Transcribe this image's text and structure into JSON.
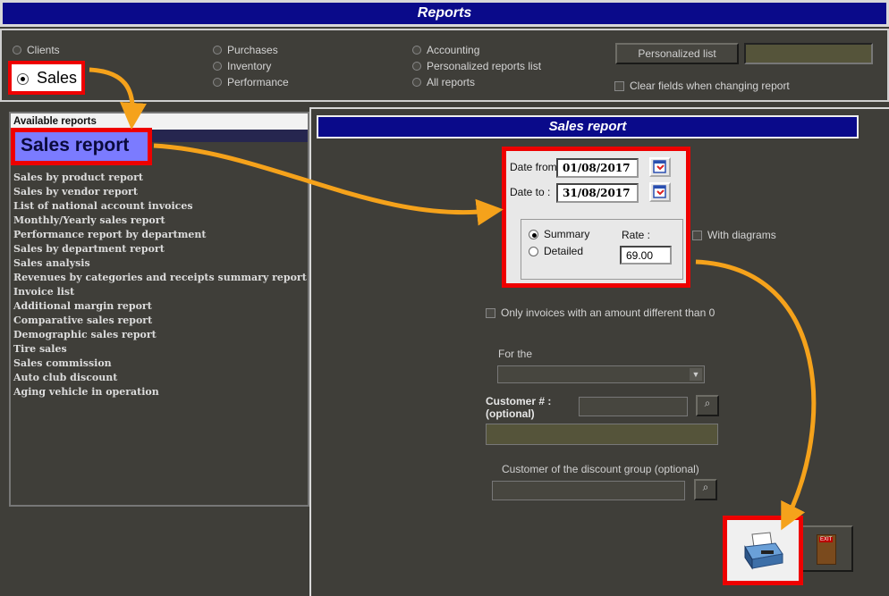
{
  "window": {
    "title": "Reports"
  },
  "report_types": {
    "col1": [
      {
        "label": "Clients",
        "selected": false
      },
      {
        "label": "Sales",
        "selected": true
      }
    ],
    "col2": [
      {
        "label": "Purchases",
        "selected": false
      },
      {
        "label": "Inventory",
        "selected": false
      },
      {
        "label": "Performance",
        "selected": false
      }
    ],
    "col3": [
      {
        "label": "Accounting",
        "selected": false
      },
      {
        "label": "Personalized reports list",
        "selected": false
      },
      {
        "label": "All reports",
        "selected": false
      }
    ]
  },
  "personalized_list": {
    "button_label": "Personalized list",
    "value": ""
  },
  "clear_fields": {
    "label": "Clear fields when changing report",
    "checked": false
  },
  "available_reports": {
    "header": "Available reports",
    "selected": "Sales report",
    "items": [
      "Sales report",
      "Sales by product report",
      "Sales by vendor report",
      "List of national account invoices",
      "Monthly/Yearly sales report",
      "Performance report by department",
      "Sales by department report",
      "Sales analysis",
      "Revenues by categories and receipts summary report",
      "Invoice list",
      "Additional margin report",
      "Comparative sales report",
      "Demographic sales report",
      "Tire sales",
      "Sales commission",
      "Auto club discount",
      "Aging vehicle in operation"
    ]
  },
  "report_panel": {
    "title": "Sales report",
    "date_from_label": "Date from",
    "date_from": "01/08/2017",
    "date_to_label": "Date to :",
    "date_to": "31/08/2017",
    "summary_label": "Summary",
    "detailed_label": "Detailed",
    "mode": "Summary",
    "rate_label": "Rate :",
    "rate": "69.00",
    "with_diagrams_label": "With diagrams",
    "only_invoices_label": "Only invoices with an amount different than 0",
    "for_the_label": "For the",
    "for_the_value": "",
    "customer_label_line1": "Customer # :",
    "customer_label_line2": "(optional)",
    "customer_value": "",
    "discount_group_label": "Customer of the discount group (optional)",
    "discount_group_value": ""
  },
  "exit_button": {
    "label": "EXIT"
  },
  "colors": {
    "titlebar": "#0a0a8a",
    "highlight": "#e00000",
    "arrow": "#f5a21b",
    "selection": "#7b7bff",
    "background": "#3f3e39"
  }
}
